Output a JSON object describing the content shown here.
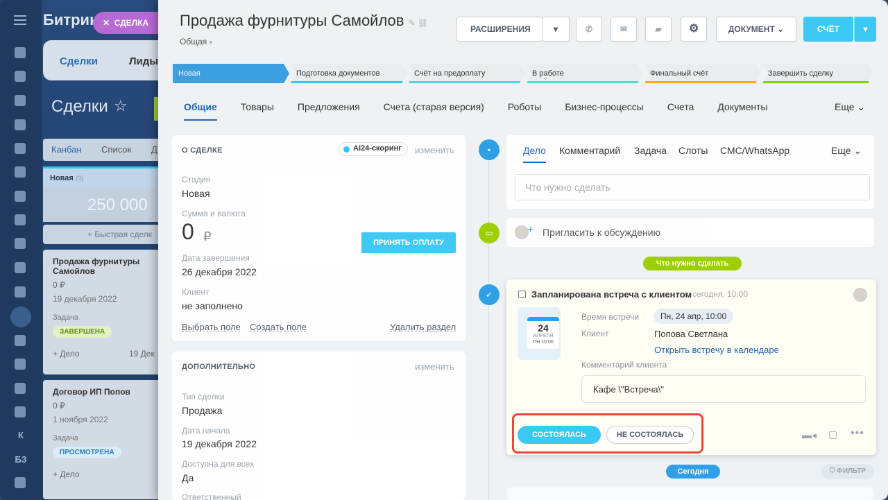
{
  "bg": {
    "logo": "Битрик",
    "chip": "СДЕЛКА",
    "tab_deals": "Сделки",
    "tab_leads": "Лиды",
    "title": "Сделки",
    "views": [
      "Канбан",
      "Список",
      "Д"
    ],
    "column": {
      "name": "Новая",
      "count": "(3)",
      "amount": "250 000",
      "quick": "Быстрая сделк"
    },
    "cards": [
      {
        "title": "Продажа фурнитуры Самойлов",
        "sum": "0 ₽",
        "date": "19 декабря 2022",
        "task_label": "Задача",
        "badge": "ЗАВЕРШЕНА",
        "foot": "+ Дело",
        "foot2": "19 Дек"
      },
      {
        "title": "Договор ИП Попов",
        "sum": "0 ₽",
        "date": "1 ноября 2022",
        "task_label": "Задача",
        "badge": "ПРОСМОТРЕНА",
        "foot": "+ Дело"
      }
    ],
    "rail_letters": [
      "К",
      "БЗ"
    ]
  },
  "deal": {
    "title": "Продажа фурнитуры Самойлов",
    "category": "Общая",
    "toolbar": {
      "ext": "РАСШИРЕНИЯ",
      "doc": "ДОКУМЕНТ",
      "invoice": "СЧЁТ"
    },
    "stages": [
      {
        "label": "Новая",
        "color": "#3b9fe0"
      },
      {
        "label": "Подготовка документов",
        "color": "#2fc6f6"
      },
      {
        "label": "Счёт на предоплату",
        "color": "#55d0e0"
      },
      {
        "label": "В работе",
        "color": "#47e4c2"
      },
      {
        "label": "Финальный счёт",
        "color": "#ffa900"
      },
      {
        "label": "Завершить сделку",
        "color": "#7bd500"
      }
    ],
    "tabs": [
      "Общие",
      "Товары",
      "Предложения",
      "Счета (старая версия)",
      "Роботы",
      "Бизнес-процессы",
      "Счета",
      "Документы"
    ],
    "tabs_more": "Еще"
  },
  "about": {
    "header": "О СДЕЛКЕ",
    "ai": "AI24-скоринг",
    "edit": "изменить",
    "fields": [
      {
        "label": "Стадия",
        "value": "Новая"
      },
      {
        "label": "Сумма и валюта",
        "value": "0"
      },
      {
        "label": "Дата завершения",
        "value": "26 декабря 2022"
      },
      {
        "label": "Клиент",
        "value": "не заполнено"
      }
    ],
    "currency": "₽",
    "pay": "ПРИНЯТЬ ОПЛАТУ",
    "links": {
      "select": "Выбрать поле",
      "create": "Создать поле",
      "delete": "Удалить раздел"
    }
  },
  "extra": {
    "header": "ДОПОЛНИТЕЛЬНО",
    "edit": "изменить",
    "fields": [
      {
        "label": "Тип сделки",
        "value": "Продажа"
      },
      {
        "label": "Дата начала",
        "value": "19 декабря 2022"
      },
      {
        "label": "Доступна для всех",
        "value": "Да"
      },
      {
        "label": "Ответственный",
        "value": ""
      }
    ]
  },
  "timeline": {
    "tabs": [
      "Дело",
      "Комментарий",
      "Задача",
      "Слоты",
      "СМС/WhatsApp"
    ],
    "more": "Еще",
    "todo_placeholder": "Что нужно сделать",
    "invite": "Пригласить к обсуждению",
    "todo_pill": "Что нужно сделать",
    "today_pill": "Сегодня",
    "filter": "ФИЛЬТР",
    "meeting": {
      "title": "Запланирована встреча с клиентом",
      "time": "сегодня, 10:00",
      "cal_day": "24",
      "cal_month": "АПРЕЛЯ",
      "cal_time": "ПН 10:00",
      "time_label": "Время встречи",
      "time_value": "Пн, 24 апр, 10:00",
      "client_label": "Клиент",
      "client_value": "Попова Светлана",
      "open_link": "Открыть встречу в календаре",
      "comment_label": "Комментарий клиента",
      "comment": "Кафе \\\"Встреча\\\"",
      "done": "СОСТОЯЛАСЬ",
      "not_done": "НЕ СОСТОЯЛАСЬ"
    }
  }
}
